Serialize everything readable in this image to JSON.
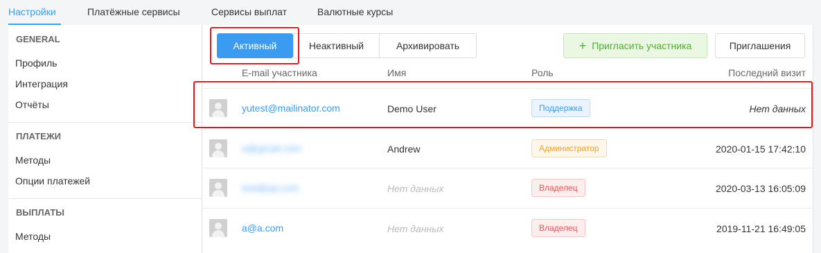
{
  "top_tabs": [
    {
      "label": "Настройки",
      "active": true
    },
    {
      "label": "Платёжные сервисы",
      "active": false
    },
    {
      "label": "Сервисы выплат",
      "active": false
    },
    {
      "label": "Валютные курсы",
      "active": false
    }
  ],
  "sidebar": {
    "sections": [
      {
        "heading": "GENERAL",
        "items": [
          "Профиль",
          "Интеграция",
          "Отчёты"
        ]
      },
      {
        "heading": "ПЛАТЕЖИ",
        "items": [
          "Методы",
          "Опции платежей"
        ]
      },
      {
        "heading": "ВЫПЛАТЫ",
        "items": [
          "Методы"
        ]
      }
    ]
  },
  "toolbar": {
    "filter_active": "Активный",
    "filter_inactive": "Неактивный",
    "filter_archive": "Архивировать",
    "invite_button": "Пригласить участника",
    "invitations_button": "Приглашения"
  },
  "table": {
    "columns": [
      "E-mail участника",
      "Имя",
      "Роль",
      "Последний визит"
    ],
    "rows": [
      {
        "email": "yutest@mailinator.com",
        "name": "Demo User",
        "role": "Поддержка",
        "last_visit": "Нет данных"
      },
      {
        "email": "a@gmail.com",
        "name": "Andrew",
        "role": "Администратор",
        "last_visit": "2020-01-15 17:42:10"
      },
      {
        "email": "test@qa.com",
        "name": "Нет данных",
        "role": "Владелец",
        "last_visit": "2020-03-13 16:05:09"
      },
      {
        "email": "a@a.com",
        "name": "Нет данных",
        "role": "Владелец",
        "last_visit": "2019-11-21 16:49:05"
      }
    ]
  },
  "colors": {
    "accent": "#3a9bf0",
    "highlight_box": "#e8141c",
    "invite_green": "#4fae32"
  }
}
